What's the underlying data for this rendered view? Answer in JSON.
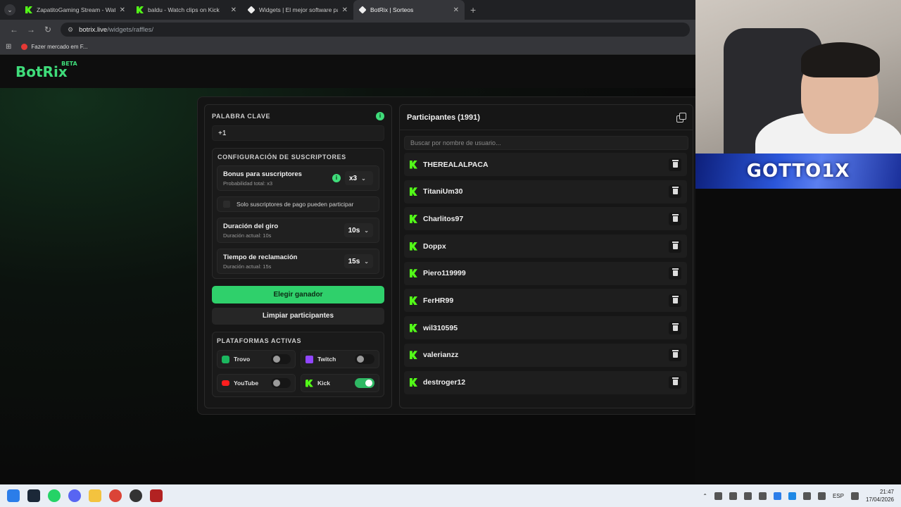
{
  "browser": {
    "tabs": [
      {
        "title": "ZapatitoGaming Stream - Watch",
        "icon": "kick",
        "active": false
      },
      {
        "title": "baldu - Watch clips on Kick",
        "icon": "kick",
        "active": false
      },
      {
        "title": "Widgets | El mejor software para",
        "icon": "bot",
        "active": false
      },
      {
        "title": "BotRix | Sorteos",
        "icon": "bot",
        "active": true
      }
    ],
    "url_host": "botrix.live",
    "url_path": "/widgets/raffles/",
    "bookmark": "Fazer mercado em F..."
  },
  "app": {
    "logo": "BotRix",
    "logo_badge": "BETA"
  },
  "keyword": {
    "label": "PALABRA CLAVE",
    "value": "+1"
  },
  "subscriber_config": {
    "label": "CONFIGURACIÓN DE SUSCRIPTORES",
    "bonus_title": "Bonus para suscriptores",
    "bonus_subtitle": "Probabilidad total: x3",
    "bonus_value": "x3",
    "paid_only_label": "Solo suscriptores de pago pueden participar",
    "spin_title": "Duración del giro",
    "spin_subtitle": "Duración actual: 10s",
    "spin_value": "10s",
    "claim_title": "Tiempo de reclamación",
    "claim_subtitle": "Duración actual: 15s",
    "claim_value": "15s"
  },
  "actions": {
    "pick_winner": "Elegir ganador",
    "clear_participants": "Limpiar participantes"
  },
  "platforms": {
    "label": "PLATAFORMAS ACTIVAS",
    "items": [
      {
        "name": "Trovo",
        "enabled": false
      },
      {
        "name": "Twitch",
        "enabled": false
      },
      {
        "name": "YouTube",
        "enabled": false
      },
      {
        "name": "Kick",
        "enabled": true
      }
    ]
  },
  "participants": {
    "title": "Participantes (1991)",
    "search_placeholder": "Buscar por nombre de usuario...",
    "list": [
      "THEREALALPACA",
      "TitaniUm30",
      "Charlitos97",
      "Doppx",
      "Piero119999",
      "FerHR99",
      "wil310595",
      "valerianzz",
      "destroger12"
    ]
  },
  "overlay": {
    "banner_text": "GOTTO1X"
  },
  "taskbar": {
    "lang": "ESP",
    "time": "21:47",
    "date": "17/04/2026"
  },
  "colors": {
    "accent_green": "#2fd06b",
    "kick_green": "#53fc18"
  }
}
